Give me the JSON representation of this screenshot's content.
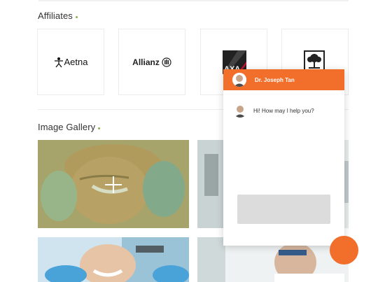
{
  "affiliates": {
    "title": "Affiliates",
    "logos": [
      {
        "name": "Aetna",
        "text": "Aetna"
      },
      {
        "name": "Allianz",
        "text": "Allianz"
      },
      {
        "name": "AXA",
        "text": "AXA"
      },
      {
        "name": "Tree",
        "text": ""
      }
    ]
  },
  "gallery": {
    "title": "Image Gallery"
  },
  "chat": {
    "agent_name": "Dr. Joseph Tan",
    "message": "Hi! How may I help you?"
  },
  "colors": {
    "accent": "#f26e2b",
    "dot": "#8fb14a"
  }
}
